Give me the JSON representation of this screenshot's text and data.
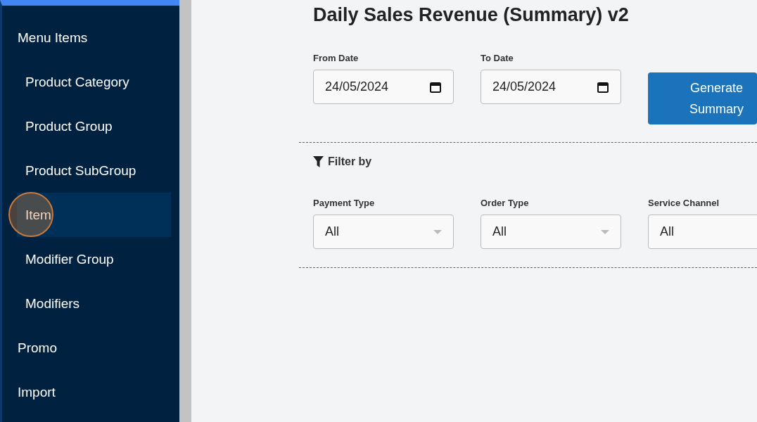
{
  "sidebar": {
    "items": [
      {
        "label": "Menu Items",
        "selected": false,
        "children": [
          {
            "label": "Product Category",
            "selected": false
          },
          {
            "label": "Product Group",
            "selected": false
          },
          {
            "label": "Product SubGroup",
            "selected": false
          },
          {
            "label": "Item",
            "selected": true
          },
          {
            "label": "Modifier Group",
            "selected": false
          },
          {
            "label": "Modifiers",
            "selected": false
          }
        ]
      },
      {
        "label": "Promo",
        "selected": false
      },
      {
        "label": "Import",
        "selected": false
      }
    ]
  },
  "page": {
    "title": "Daily Sales Revenue (Summary) v2",
    "date_fields": [
      {
        "label": "From Date",
        "value": "24/05/2024"
      },
      {
        "label": "To Date",
        "value": "24/05/2024"
      }
    ],
    "generate_button": "Generate Summary",
    "filter_title": "Filter by",
    "filters": [
      {
        "label": "Payment Type",
        "value": "All"
      },
      {
        "label": "Order Type",
        "value": "All"
      },
      {
        "label": "Service Channel",
        "value": "All"
      }
    ]
  }
}
